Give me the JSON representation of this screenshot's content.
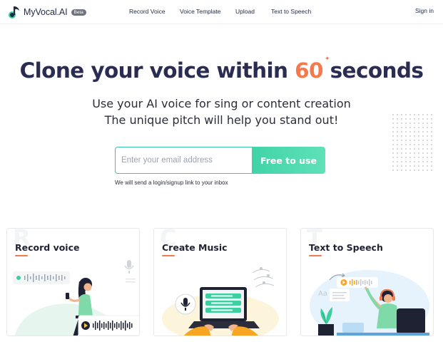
{
  "nav": {
    "brand": "MyVocal.AI",
    "badge": "Beta",
    "links": [
      "Record Voice",
      "Voice Template",
      "Upload",
      "Text to Speech"
    ],
    "sign_in": "Sign in"
  },
  "hero": {
    "title_before": "Clone your voice within ",
    "title_accent": "60",
    "title_after": " seconds",
    "subtitle_line1": "Use your AI voice for sing or content creation",
    "subtitle_line2": "The unique pitch will help you stand out!"
  },
  "signup": {
    "placeholder": "Enter your email address",
    "button": "Free to use",
    "hint": "We will send a login/signup link to your inbox"
  },
  "cards": [
    {
      "title": "Record voice",
      "ghost": "R"
    },
    {
      "title": "Create Music",
      "ghost": "C"
    },
    {
      "title": "Text to Speech",
      "ghost": "T"
    }
  ],
  "colors": {
    "accent": "#f47a4e",
    "brand_green": "#41d3a7",
    "title": "#2a2c52"
  }
}
